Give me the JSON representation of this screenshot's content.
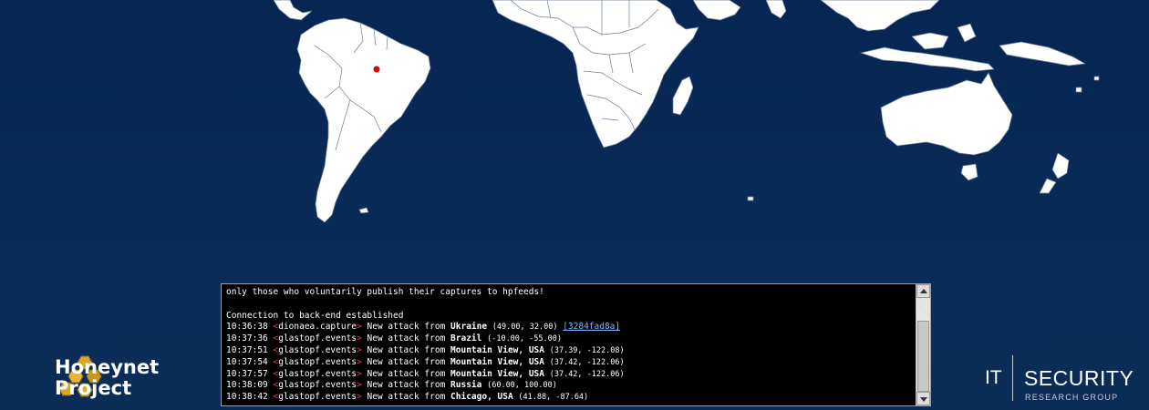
{
  "log": {
    "lines": [
      {
        "type": "text",
        "text": "only those who voluntarily publish their captures to hpfeeds!"
      },
      {
        "type": "blank"
      },
      {
        "type": "text",
        "text": "Connection to back-end established"
      },
      {
        "type": "attack",
        "time": "10:36:38",
        "channel": "dionaea.capture",
        "action": "New attack from",
        "place": "Ukraine",
        "coords": "(49.00, 32.00)",
        "hash": "[3284fad8a]"
      },
      {
        "type": "attack",
        "time": "10:37:36",
        "channel": "glastopf.events",
        "action": "New attack from",
        "place": "Brazil",
        "coords": "(-10.00, -55.00)"
      },
      {
        "type": "attack",
        "time": "10:37:51",
        "channel": "glastopf.events",
        "action": "New attack from",
        "place": "Mountain View, USA",
        "coords": "(37.39, -122.08)"
      },
      {
        "type": "attack",
        "time": "10:37:54",
        "channel": "glastopf.events",
        "action": "New attack from",
        "place": "Mountain View, USA",
        "coords": "(37.42, -122.06)"
      },
      {
        "type": "attack",
        "time": "10:37:57",
        "channel": "glastopf.events",
        "action": "New attack from",
        "place": "Mountain View, USA",
        "coords": "(37.42, -122.06)"
      },
      {
        "type": "attack",
        "time": "10:38:09",
        "channel": "glastopf.events",
        "action": "New attack from",
        "place": "Russia",
        "coords": "(60.00, 100.00)"
      },
      {
        "type": "attack",
        "time": "10:38:42",
        "channel": "glastopf.events",
        "action": "New attack from",
        "place": "Chicago, USA",
        "coords": "(41.88, -87.64)"
      }
    ]
  },
  "logos": {
    "honeynet_line1": "Honeynet",
    "honeynet_line2": "Project",
    "it": "IT",
    "security": "SECURITY",
    "research_group": "RESEARCH GROUP"
  },
  "colors": {
    "background": "#0a2a57",
    "land": "#ffffff",
    "marker": "#e00000",
    "bracket": "#e04040",
    "hash_link": "#7fb6ff",
    "honeycomb": "#d8a629"
  }
}
